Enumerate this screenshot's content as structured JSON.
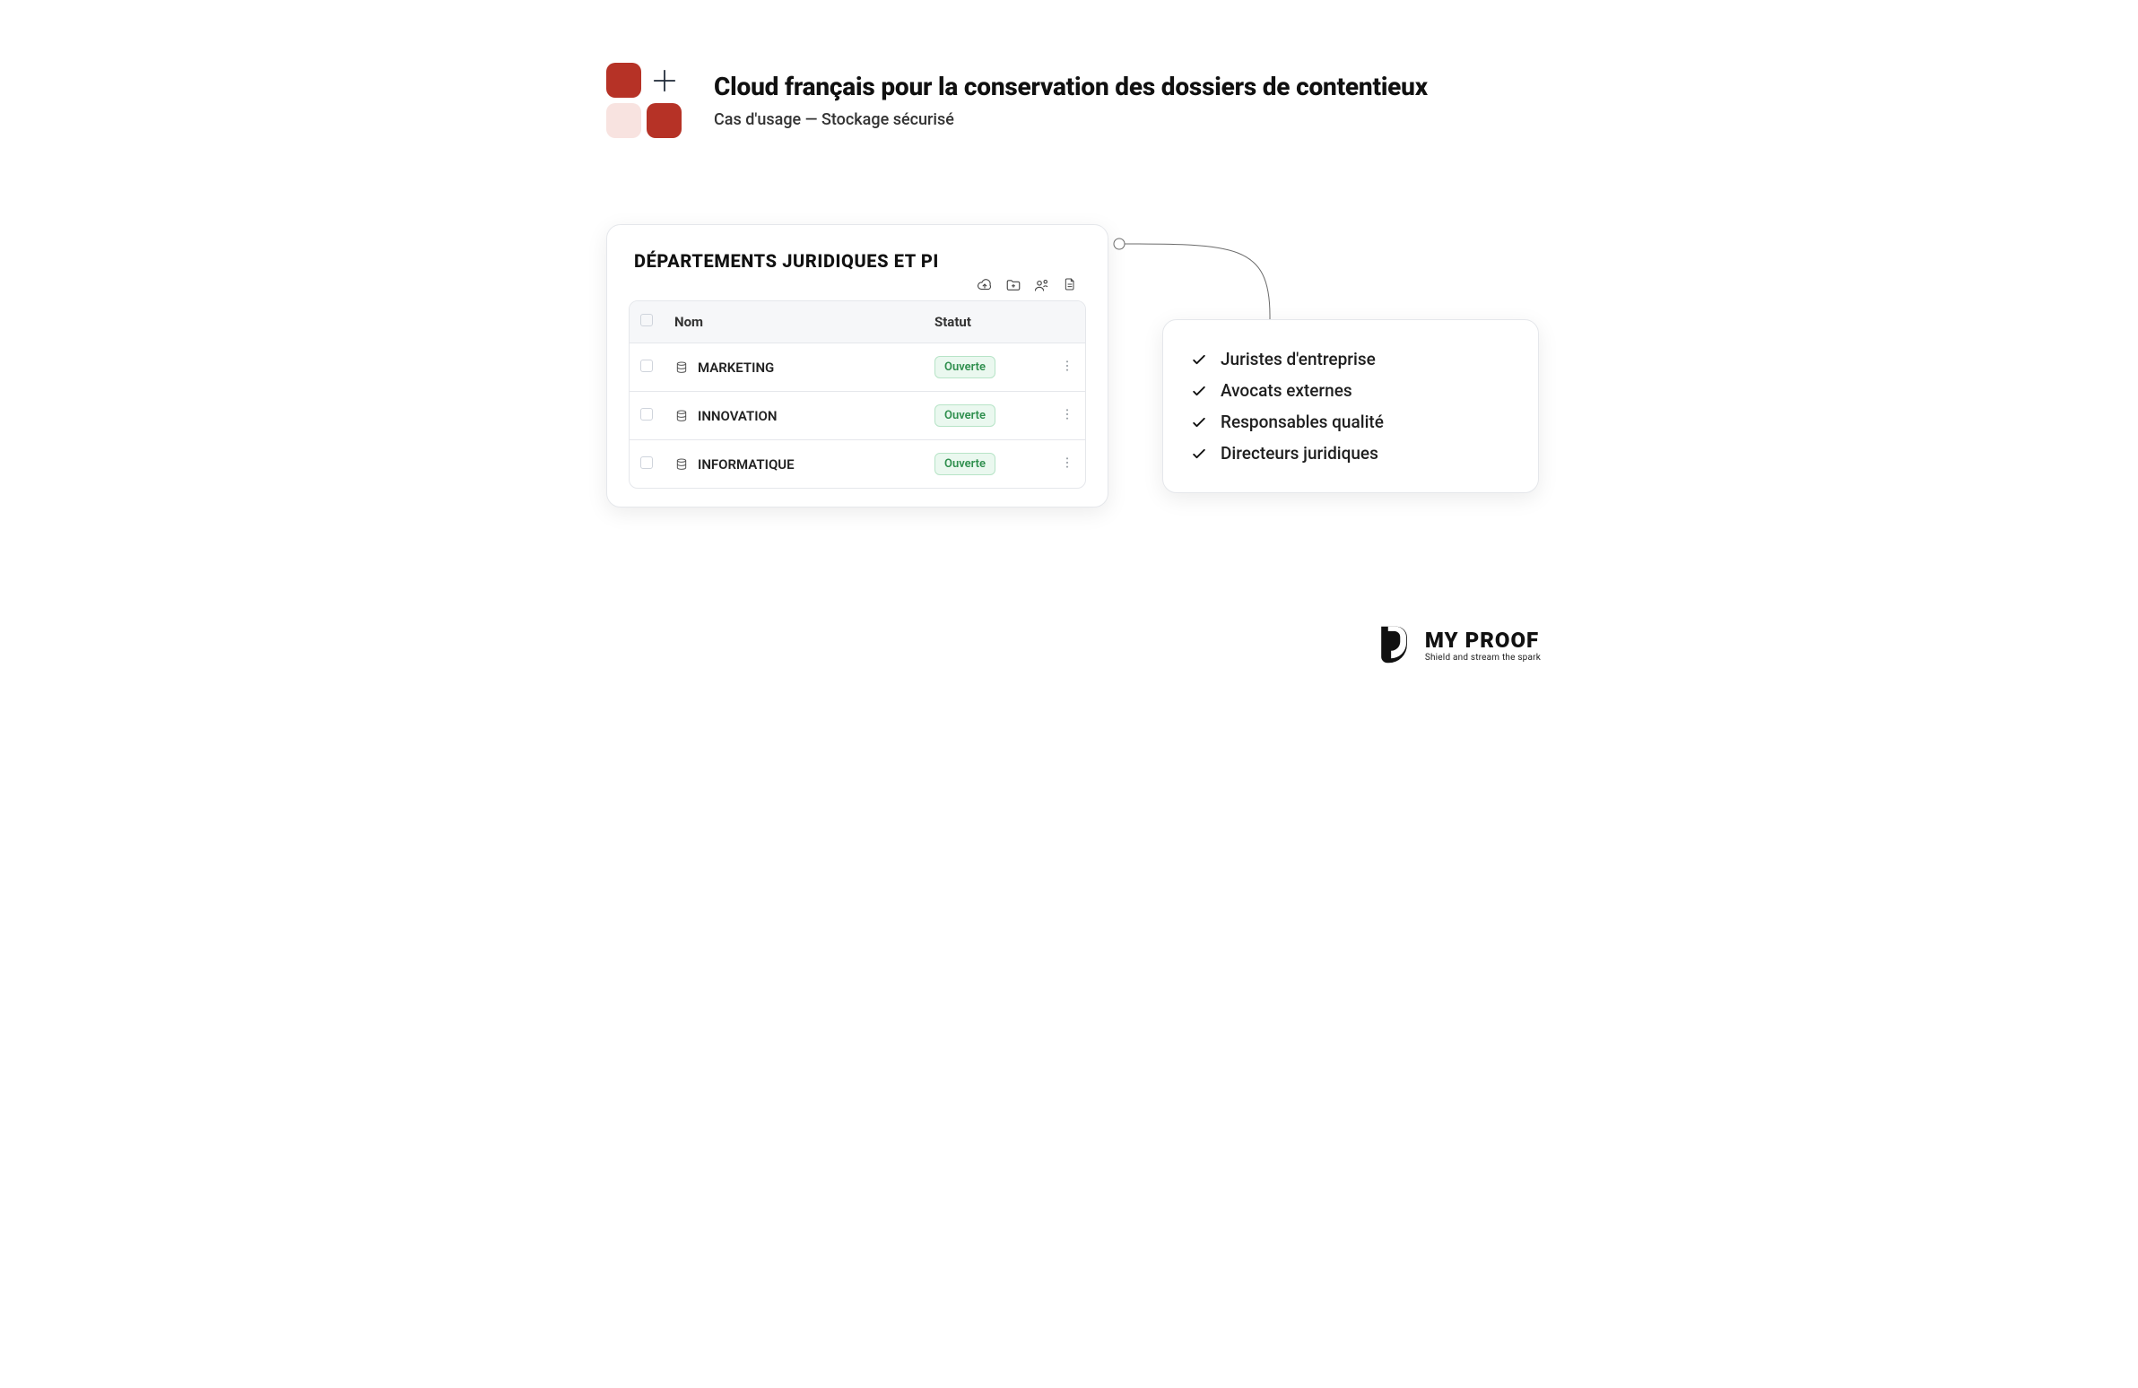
{
  "header": {
    "title": "Cloud français pour la conservation des dossiers de contentieux",
    "subtitle": "Cas d'usage — Stockage sécurisé"
  },
  "table_panel": {
    "title": "DÉPARTEMENTS JURIDIQUES ET PI",
    "columns": {
      "name": "Nom",
      "status": "Statut"
    },
    "actions": {
      "upload": "Téléverser",
      "new_folder": "Nouveau dossier",
      "share": "Partager",
      "document": "Document"
    },
    "rows": [
      {
        "name": "MARKETING",
        "status": "Ouverte"
      },
      {
        "name": "INNOVATION",
        "status": "Ouverte"
      },
      {
        "name": "INFORMATIQUE",
        "status": "Ouverte"
      }
    ]
  },
  "audience": {
    "items": [
      "Juristes d'entreprise",
      "Avocats externes",
      "Responsables qualité",
      "Directeurs juridiques"
    ]
  },
  "brand": {
    "name": "MY PROOF",
    "tagline": "Shield and stream the spark"
  }
}
